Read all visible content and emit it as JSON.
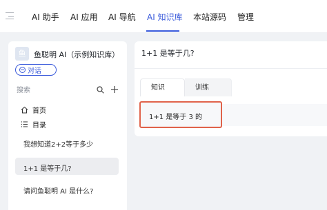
{
  "nav": {
    "items": [
      {
        "label": "AI 助手",
        "active": false
      },
      {
        "label": "AI 应用",
        "active": false
      },
      {
        "label": "AI 导航",
        "active": false
      },
      {
        "label": "AI 知识库",
        "active": true
      },
      {
        "label": "本站源码",
        "active": false
      },
      {
        "label": "管理",
        "active": false
      }
    ],
    "accent_color": "#3b5bdb"
  },
  "sidebar": {
    "kb_logo_text": "鱼",
    "kb_title": "鱼聪明 AI（示例知识库）",
    "chat_badge_label": "对话",
    "search_placeholder": "搜索",
    "home_label": "首页",
    "toc_label": "目录",
    "documents": [
      {
        "title": "我想知道2+2等于多少",
        "active": false
      },
      {
        "title": "1+1 是等于几?",
        "active": true
      },
      {
        "title": "请问鱼聪明 AI 是什么?",
        "active": false
      }
    ]
  },
  "main": {
    "question_title": "1+1 是等于几?",
    "tabs": [
      {
        "label": "知识",
        "active": true
      },
      {
        "label": "训练",
        "active": false
      }
    ],
    "answer_text": "1+1 是等于 3 的",
    "highlight_color": "#e0624a"
  }
}
